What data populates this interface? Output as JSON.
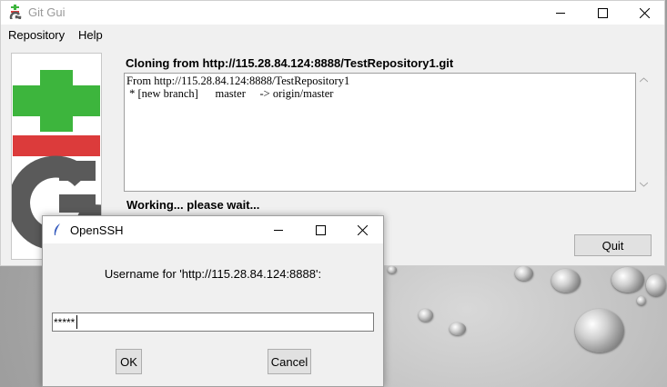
{
  "window": {
    "title": "Git Gui"
  },
  "menu": [
    "Repository",
    "Help"
  ],
  "clone": {
    "heading": "Cloning from http://115.28.84.124:8888/TestRepository1.git",
    "log": [
      "From http://115.28.84.124:8888/TestRepository1",
      " * [new branch]      master     -> origin/master"
    ],
    "status": "Working... please wait...",
    "quit_label": "Quit"
  },
  "dialog": {
    "title": "OpenSSH",
    "prompt": "Username for 'http://115.28.84.124:8888':",
    "input_value": "*****",
    "ok_label": "OK",
    "cancel_label": "Cancel"
  },
  "colors": {
    "logo_green": "#3db53d",
    "logo_red": "#dc3b3b",
    "logo_gray": "#5a5a5a"
  }
}
